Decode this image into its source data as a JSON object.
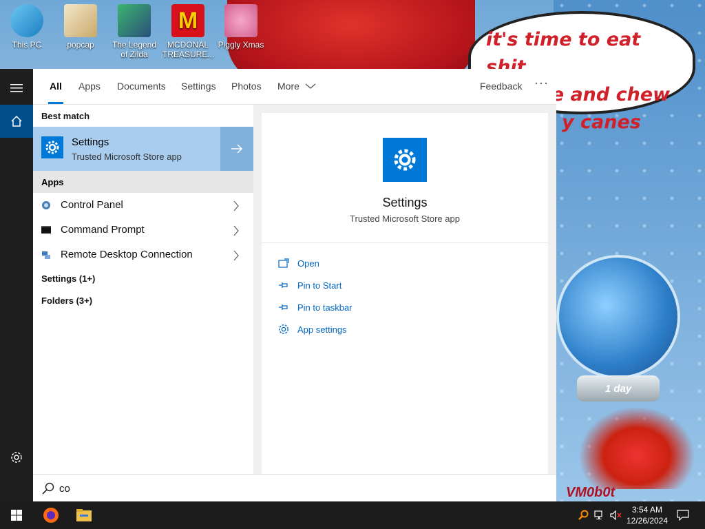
{
  "desktop": {
    "icons": [
      {
        "label": "This PC",
        "icon": "computer-icon"
      },
      {
        "label": "popcap",
        "icon": "popcap-icon"
      },
      {
        "label": "The Legend of Zilda",
        "icon": "game-icon"
      },
      {
        "label": "MCDONAL TREASURE...",
        "icon": "mcdonalds-icon"
      },
      {
        "label": "Piggly Xmas",
        "icon": "pig-icon"
      }
    ],
    "wallpaper": {
      "speech_line1": "it's time to eat shit",
      "speech_line2": "and die and chew",
      "speech_line3": "y canes",
      "globe_label": "1 day",
      "watermark": "VM0b0t"
    }
  },
  "start_menu": {
    "tabs": [
      {
        "label": "All",
        "active": true
      },
      {
        "label": "Apps"
      },
      {
        "label": "Documents"
      },
      {
        "label": "Settings"
      },
      {
        "label": "Photos"
      },
      {
        "label": "More"
      }
    ],
    "feedback_label": "Feedback",
    "more_options": "···",
    "best_match_label": "Best match",
    "best_match": {
      "title": "Settings",
      "subtitle": "Trusted Microsoft Store app",
      "icon": "gear-icon"
    },
    "apps_label": "Apps",
    "apps": [
      {
        "label": "Control Panel",
        "icon": "control-panel-icon"
      },
      {
        "label": "Command Prompt",
        "icon": "command-prompt-icon"
      },
      {
        "label": "Remote Desktop Connection",
        "icon": "remote-desktop-icon"
      }
    ],
    "categories": [
      {
        "label": "Settings (1+)"
      },
      {
        "label": "Folders (3+)"
      }
    ],
    "detail": {
      "title": "Settings",
      "subtitle": "Trusted Microsoft Store app",
      "actions": [
        {
          "label": "Open",
          "icon": "open-icon"
        },
        {
          "label": "Pin to Start",
          "icon": "pin-icon"
        },
        {
          "label": "Pin to taskbar",
          "icon": "pin-icon"
        },
        {
          "label": "App settings",
          "icon": "gear-icon"
        }
      ]
    },
    "search": {
      "value": "co"
    }
  },
  "taskbar": {
    "time": "3:54 AM",
    "date": "12/26/2024",
    "pinned": [
      {
        "name": "firefox-icon"
      },
      {
        "name": "file-explorer-icon"
      }
    ]
  },
  "colors": {
    "accent": "#0078d7",
    "selection": "#a9cdef",
    "taskbar": "#1c1c1c",
    "rail": "#1f1f1f"
  }
}
